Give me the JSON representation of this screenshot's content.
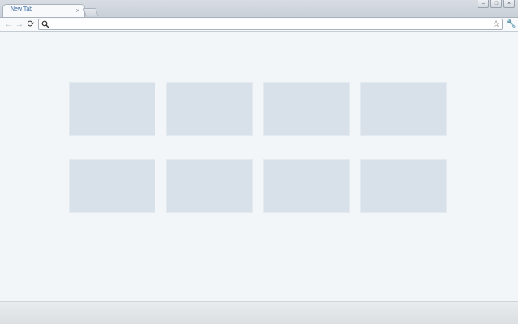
{
  "tab": {
    "title": "New Tab",
    "close_glyph": "×"
  },
  "window_buttons": {
    "minimize": "–",
    "maximize": "□",
    "close": "×"
  },
  "toolbar": {
    "back_glyph": "←",
    "forward_glyph": "→",
    "reload_glyph": "⟳",
    "omnibox_value": "",
    "bookmark_glyph": "☆",
    "wrench_glyph": "🔧"
  },
  "colors": {
    "accent_tab_text": "#3b6aa0",
    "thumbnail": "#d8e1e9",
    "page_bg": "#f3f6f9"
  },
  "icons": [
    "close-icon",
    "back-arrow-icon",
    "forward-arrow-icon",
    "reload-icon",
    "search-icon",
    "star-icon",
    "wrench-icon"
  ],
  "thumbnails": [
    {
      "label": ""
    },
    {
      "label": ""
    },
    {
      "label": ""
    },
    {
      "label": ""
    },
    {
      "label": ""
    },
    {
      "label": ""
    },
    {
      "label": ""
    },
    {
      "label": ""
    }
  ]
}
